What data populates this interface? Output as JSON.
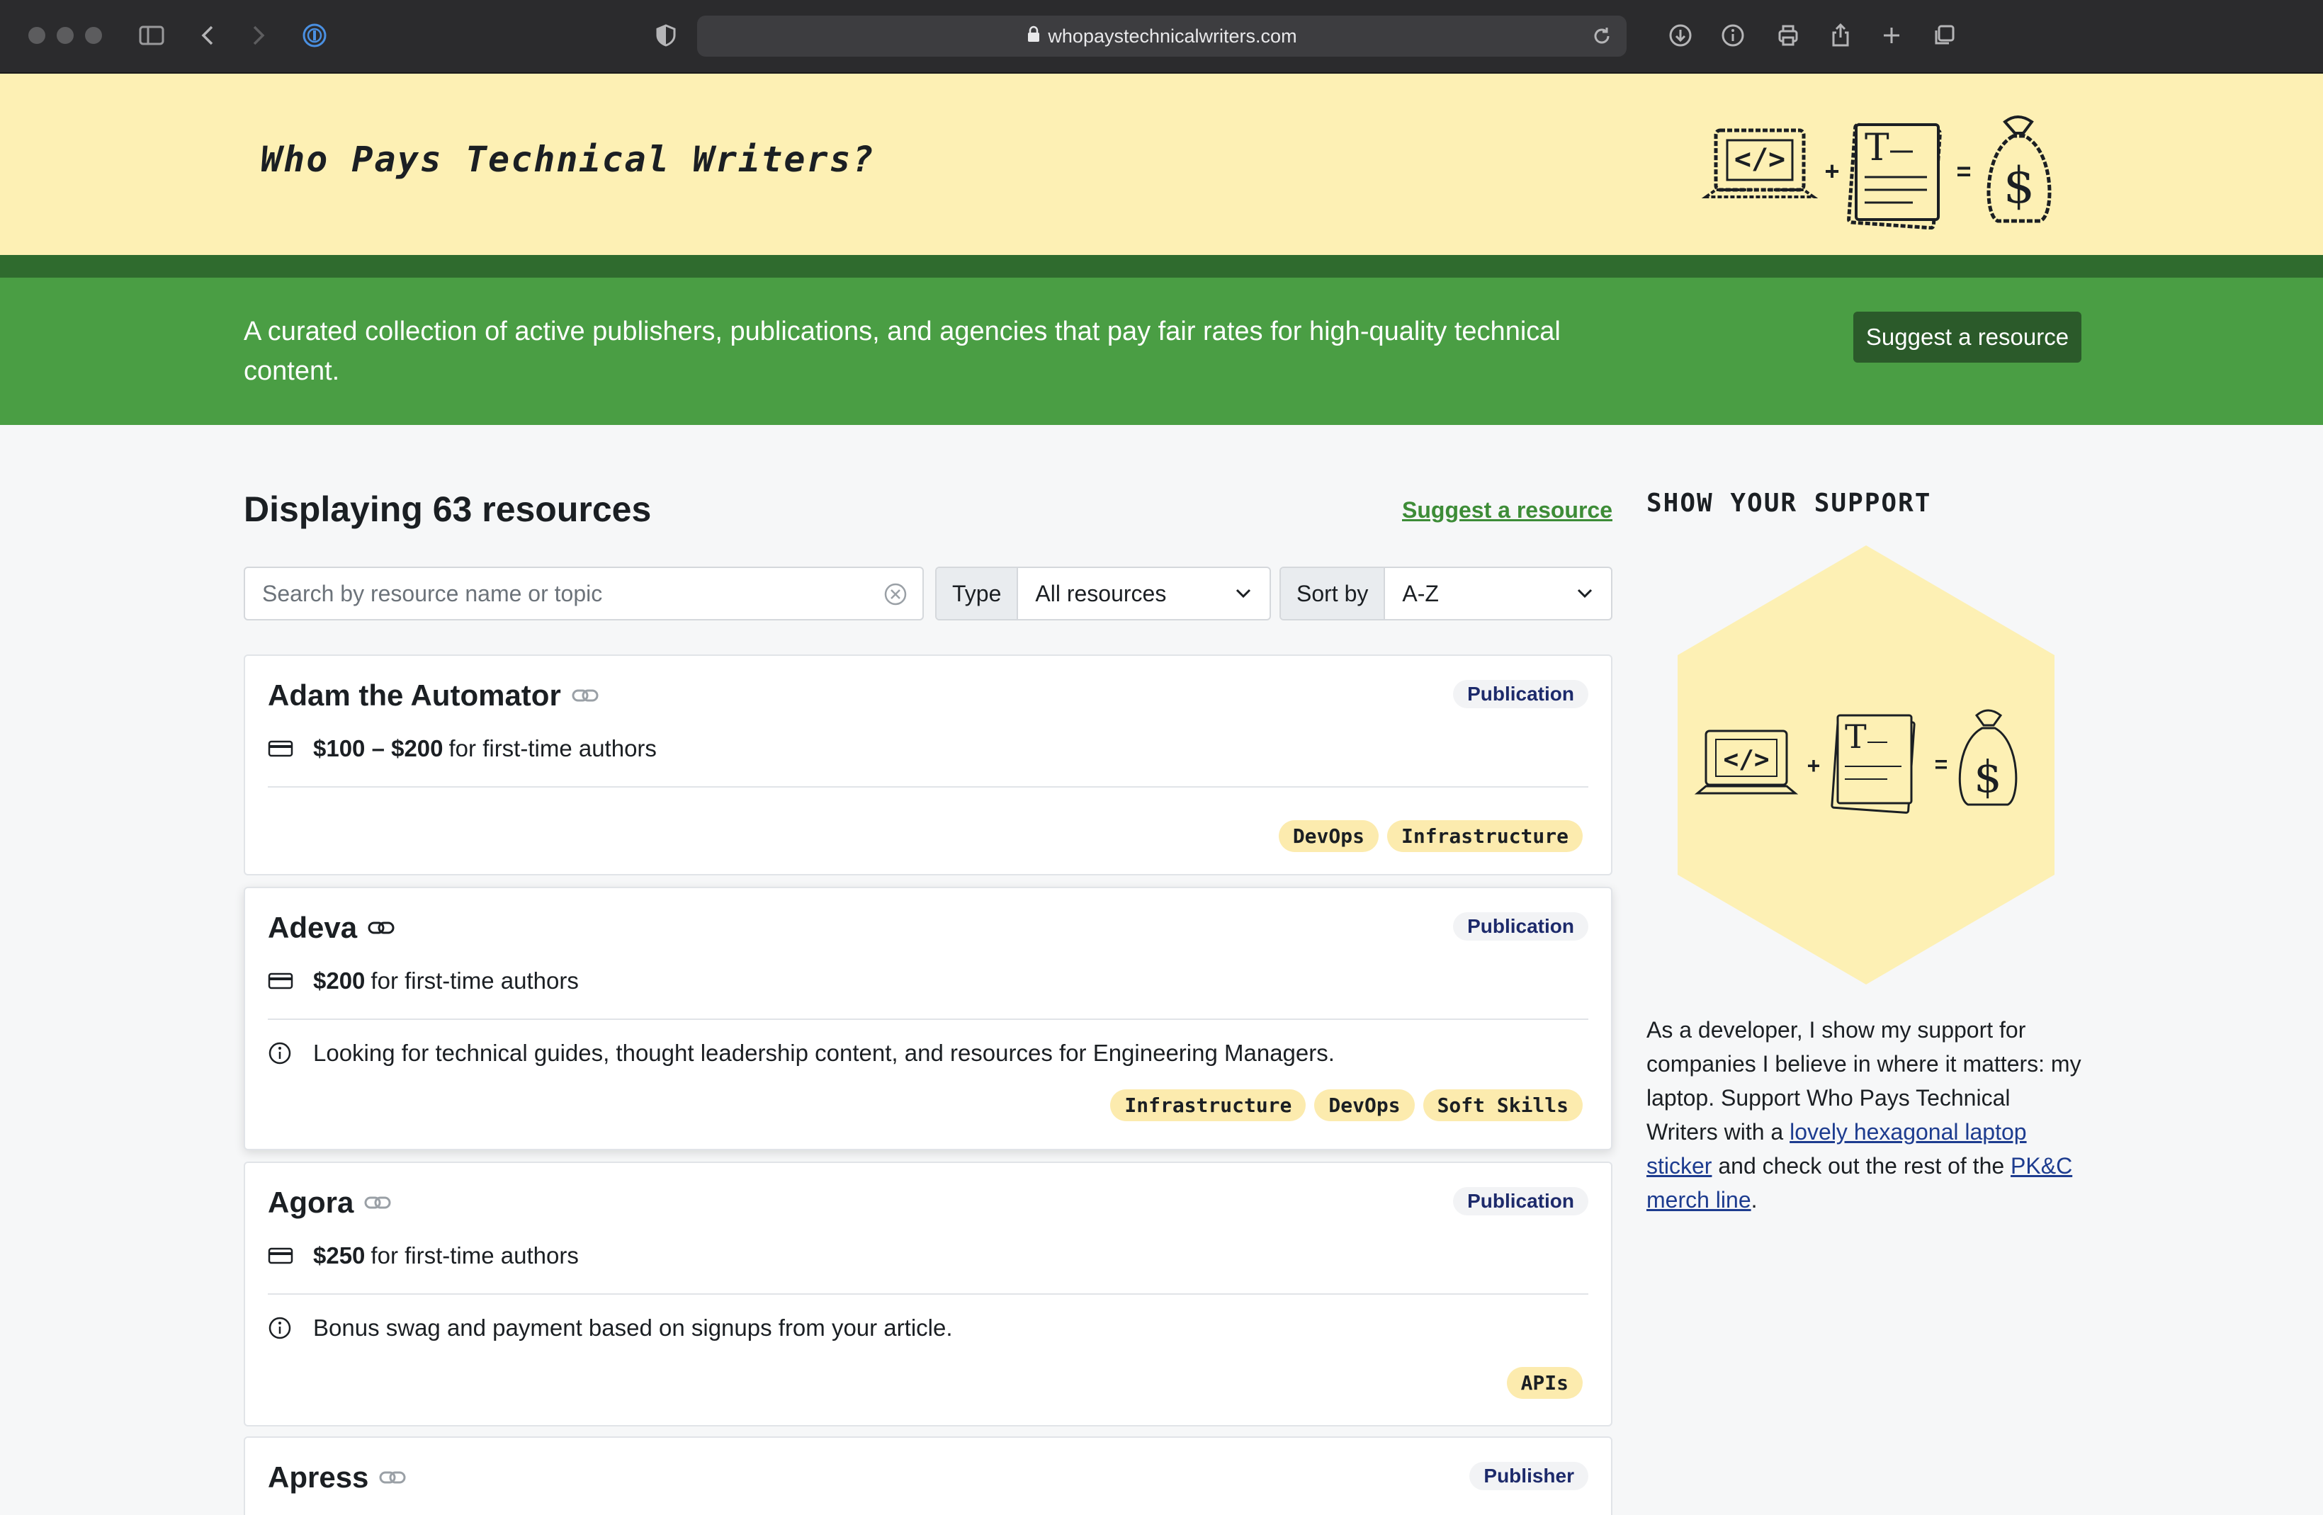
{
  "browser": {
    "url": "whopaystechnicalwriters.com"
  },
  "header": {
    "site_title": "Who Pays Technical Writers?",
    "logo_tag_letter": "T",
    "logo_plus": "+",
    "logo_equals": "=",
    "logo_code": "</>",
    "logo_dollar": "$"
  },
  "banner": {
    "text": "A curated collection of active publishers, publications, and agencies that pay fair rates for high-quality technical content.",
    "button_label": "Suggest a resource"
  },
  "list": {
    "title": "Displaying 63 resources",
    "suggest_link": "Suggest a resource",
    "search_placeholder": "Search by resource name or topic",
    "type_label": "Type",
    "type_value": "All resources",
    "sort_label": "Sort by",
    "sort_value": "A-Z"
  },
  "resources": [
    {
      "name": "Adam the Automator",
      "type": "Publication",
      "pay_amount": "$100 – $200",
      "pay_suffix": "for first-time authors",
      "note": "",
      "tags": [
        "DevOps",
        "Infrastructure"
      ]
    },
    {
      "name": "Adeva",
      "type": "Publication",
      "pay_amount": "$200",
      "pay_suffix": "for first-time authors",
      "note": "Looking for technical guides, thought leadership content, and resources for Engineering Managers.",
      "tags": [
        "Infrastructure",
        "DevOps",
        "Soft Skills"
      ]
    },
    {
      "name": "Agora",
      "type": "Publication",
      "pay_amount": "$250",
      "pay_suffix": "for first-time authors",
      "note": "Bonus swag and payment based on signups from your article.",
      "tags": [
        "APIs"
      ]
    },
    {
      "name": "Apress",
      "type": "Publisher"
    }
  ],
  "sidebar": {
    "title": "SHOW YOUR SUPPORT",
    "text_1": "As a developer, I show my support for companies I believe in where it matters: my laptop. Support Who Pays Technical Writers with a ",
    "link_1": "lovely hexagonal laptop sticker",
    "text_2": " and check out the rest of the ",
    "link_2": "PK&C merch line",
    "text_3": "."
  }
}
